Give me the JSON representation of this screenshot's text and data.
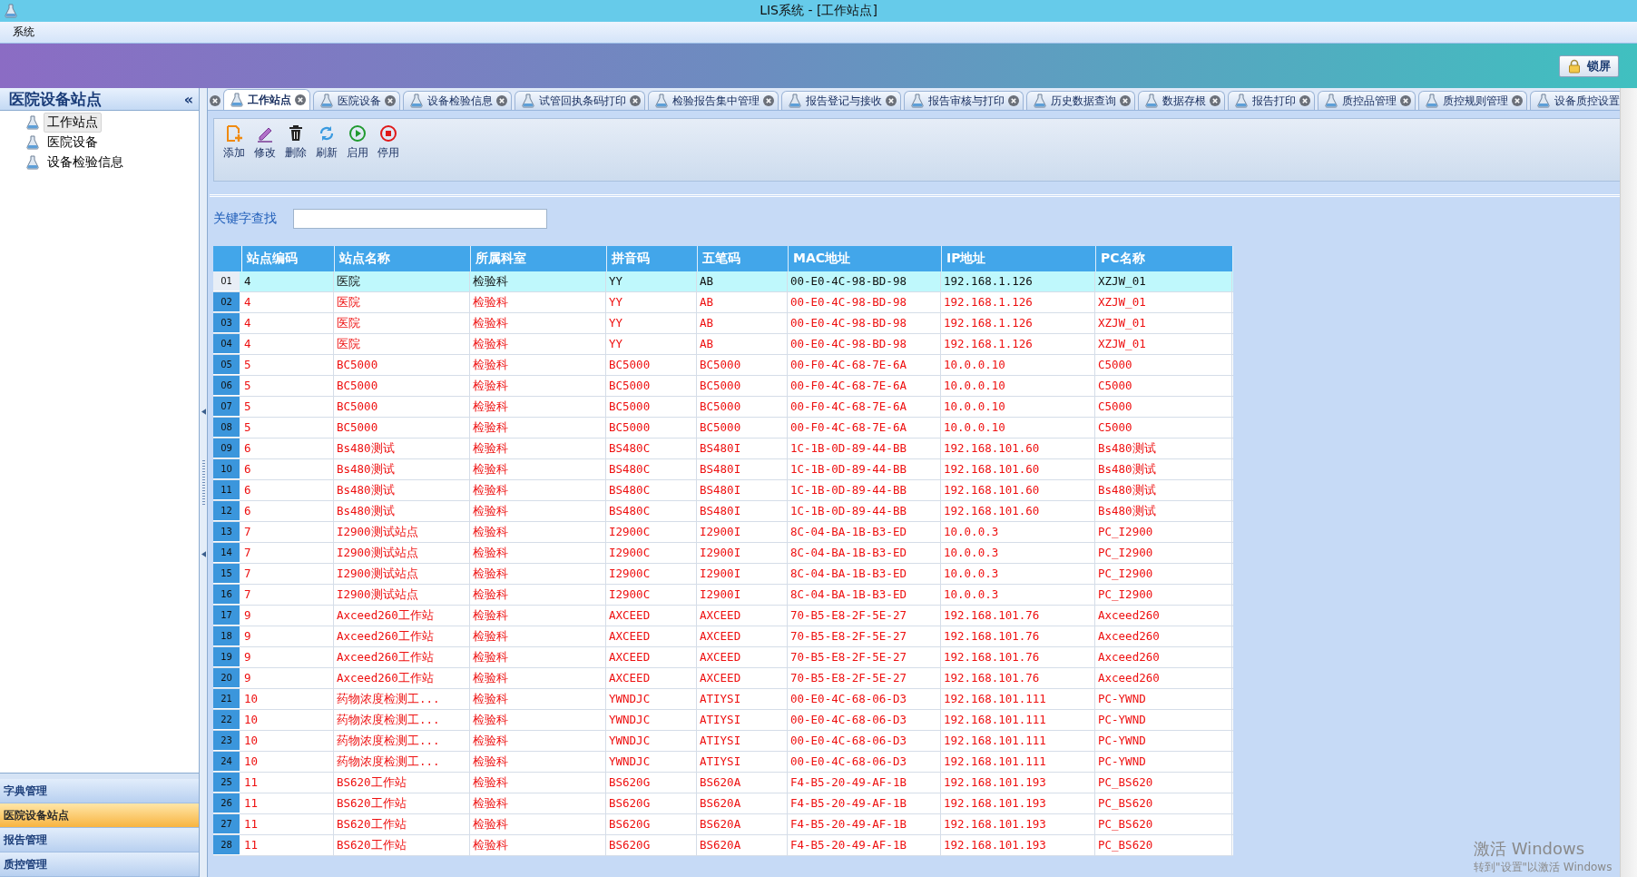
{
  "window": {
    "title": "LIS系统 - [工作站点]"
  },
  "menu": [
    "系统"
  ],
  "lock_button": "锁屏",
  "sidebar": {
    "title": "医院设备站点",
    "collapse": "«",
    "items": [
      {
        "label": "工作站点",
        "selected": true
      },
      {
        "label": "医院设备",
        "selected": false
      },
      {
        "label": "设备检验信息",
        "selected": false
      }
    ],
    "sections": [
      {
        "label": "字典管理",
        "selected": false
      },
      {
        "label": "医院设备站点",
        "selected": true
      },
      {
        "label": "报告管理",
        "selected": false
      },
      {
        "label": "质控管理",
        "selected": false
      }
    ]
  },
  "tabs": [
    {
      "label": "工作站点",
      "selected": true
    },
    {
      "label": "医院设备",
      "selected": false
    },
    {
      "label": "设备检验信息",
      "selected": false
    },
    {
      "label": "试管回执条码打印",
      "selected": false
    },
    {
      "label": "检验报告集中管理",
      "selected": false
    },
    {
      "label": "报告登记与接收",
      "selected": false
    },
    {
      "label": "报告审核与打印",
      "selected": false
    },
    {
      "label": "历史数据查询",
      "selected": false
    },
    {
      "label": "数据存根",
      "selected": false
    },
    {
      "label": "报告打印",
      "selected": false
    },
    {
      "label": "质控品管理",
      "selected": false
    },
    {
      "label": "质控规则管理",
      "selected": false
    },
    {
      "label": "设备质控设置",
      "selected": false
    }
  ],
  "toolbar": [
    {
      "kind": "add",
      "label": "添加"
    },
    {
      "kind": "edit",
      "label": "修改"
    },
    {
      "kind": "delete",
      "label": "删除"
    },
    {
      "kind": "refresh",
      "label": "刷新"
    },
    {
      "kind": "enable",
      "label": "启用"
    },
    {
      "kind": "disable",
      "label": "停用"
    }
  ],
  "search": {
    "label": "关键字查找"
  },
  "table": {
    "columns": [
      "站点编码",
      "站点名称",
      "所属科室",
      "拼音码",
      "五笔码",
      "MAC地址",
      "IP地址",
      "PC名称"
    ],
    "rows": [
      {
        "num": "01",
        "selected": true,
        "cells": [
          "4",
          "医院",
          "检验科",
          "YY",
          "AB",
          "00-E0-4C-98-BD-98",
          "192.168.1.126",
          "XZJW_01"
        ]
      },
      {
        "num": "02",
        "selected": false,
        "cells": [
          "4",
          "医院",
          "检验科",
          "YY",
          "AB",
          "00-E0-4C-98-BD-98",
          "192.168.1.126",
          "XZJW_01"
        ]
      },
      {
        "num": "03",
        "selected": false,
        "cells": [
          "4",
          "医院",
          "检验科",
          "YY",
          "AB",
          "00-E0-4C-98-BD-98",
          "192.168.1.126",
          "XZJW_01"
        ]
      },
      {
        "num": "04",
        "selected": false,
        "cells": [
          "4",
          "医院",
          "检验科",
          "YY",
          "AB",
          "00-E0-4C-98-BD-98",
          "192.168.1.126",
          "XZJW_01"
        ]
      },
      {
        "num": "05",
        "selected": false,
        "cells": [
          "5",
          "BC5000",
          "检验科",
          "BC5000",
          "BC5000",
          "00-F0-4C-68-7E-6A",
          "10.0.0.10",
          "C5000"
        ]
      },
      {
        "num": "06",
        "selected": false,
        "cells": [
          "5",
          "BC5000",
          "检验科",
          "BC5000",
          "BC5000",
          "00-F0-4C-68-7E-6A",
          "10.0.0.10",
          "C5000"
        ]
      },
      {
        "num": "07",
        "selected": false,
        "cells": [
          "5",
          "BC5000",
          "检验科",
          "BC5000",
          "BC5000",
          "00-F0-4C-68-7E-6A",
          "10.0.0.10",
          "C5000"
        ]
      },
      {
        "num": "08",
        "selected": false,
        "cells": [
          "5",
          "BC5000",
          "检验科",
          "BC5000",
          "BC5000",
          "00-F0-4C-68-7E-6A",
          "10.0.0.10",
          "C5000"
        ]
      },
      {
        "num": "09",
        "selected": false,
        "cells": [
          "6",
          "Bs480测试",
          "检验科",
          "BS480C",
          "BS480I",
          "1C-1B-0D-89-44-BB",
          "192.168.101.60",
          "Bs480测试"
        ]
      },
      {
        "num": "10",
        "selected": false,
        "cells": [
          "6",
          "Bs480测试",
          "检验科",
          "BS480C",
          "BS480I",
          "1C-1B-0D-89-44-BB",
          "192.168.101.60",
          "Bs480测试"
        ]
      },
      {
        "num": "11",
        "selected": false,
        "cells": [
          "6",
          "Bs480测试",
          "检验科",
          "BS480C",
          "BS480I",
          "1C-1B-0D-89-44-BB",
          "192.168.101.60",
          "Bs480测试"
        ]
      },
      {
        "num": "12",
        "selected": false,
        "cells": [
          "6",
          "Bs480测试",
          "检验科",
          "BS480C",
          "BS480I",
          "1C-1B-0D-89-44-BB",
          "192.168.101.60",
          "Bs480测试"
        ]
      },
      {
        "num": "13",
        "selected": false,
        "cells": [
          "7",
          "I2900测试站点",
          "检验科",
          "I2900C",
          "I2900I",
          "8C-04-BA-1B-B3-ED",
          "10.0.0.3",
          "PC_I2900"
        ]
      },
      {
        "num": "14",
        "selected": false,
        "cells": [
          "7",
          "I2900测试站点",
          "检验科",
          "I2900C",
          "I2900I",
          "8C-04-BA-1B-B3-ED",
          "10.0.0.3",
          "PC_I2900"
        ]
      },
      {
        "num": "15",
        "selected": false,
        "cells": [
          "7",
          "I2900测试站点",
          "检验科",
          "I2900C",
          "I2900I",
          "8C-04-BA-1B-B3-ED",
          "10.0.0.3",
          "PC_I2900"
        ]
      },
      {
        "num": "16",
        "selected": false,
        "cells": [
          "7",
          "I2900测试站点",
          "检验科",
          "I2900C",
          "I2900I",
          "8C-04-BA-1B-B3-ED",
          "10.0.0.3",
          "PC_I2900"
        ]
      },
      {
        "num": "17",
        "selected": false,
        "cells": [
          "9",
          "Axceed260工作站",
          "检验科",
          "AXCEED",
          "AXCEED",
          "70-B5-E8-2F-5E-27",
          "192.168.101.76",
          "Axceed260"
        ]
      },
      {
        "num": "18",
        "selected": false,
        "cells": [
          "9",
          "Axceed260工作站",
          "检验科",
          "AXCEED",
          "AXCEED",
          "70-B5-E8-2F-5E-27",
          "192.168.101.76",
          "Axceed260"
        ]
      },
      {
        "num": "19",
        "selected": false,
        "cells": [
          "9",
          "Axceed260工作站",
          "检验科",
          "AXCEED",
          "AXCEED",
          "70-B5-E8-2F-5E-27",
          "192.168.101.76",
          "Axceed260"
        ]
      },
      {
        "num": "20",
        "selected": false,
        "cells": [
          "9",
          "Axceed260工作站",
          "检验科",
          "AXCEED",
          "AXCEED",
          "70-B5-E8-2F-5E-27",
          "192.168.101.76",
          "Axceed260"
        ]
      },
      {
        "num": "21",
        "selected": false,
        "cells": [
          "10",
          "药物浓度检测工...",
          "检验科",
          "YWNDJC",
          "ATIYSI",
          "00-E0-4C-68-06-D3",
          "192.168.101.111",
          "PC-YWND"
        ]
      },
      {
        "num": "22",
        "selected": false,
        "cells": [
          "10",
          "药物浓度检测工...",
          "检验科",
          "YWNDJC",
          "ATIYSI",
          "00-E0-4C-68-06-D3",
          "192.168.101.111",
          "PC-YWND"
        ]
      },
      {
        "num": "23",
        "selected": false,
        "cells": [
          "10",
          "药物浓度检测工...",
          "检验科",
          "YWNDJC",
          "ATIYSI",
          "00-E0-4C-68-06-D3",
          "192.168.101.111",
          "PC-YWND"
        ]
      },
      {
        "num": "24",
        "selected": false,
        "cells": [
          "10",
          "药物浓度检测工...",
          "检验科",
          "YWNDJC",
          "ATIYSI",
          "00-E0-4C-68-06-D3",
          "192.168.101.111",
          "PC-YWND"
        ]
      },
      {
        "num": "25",
        "selected": false,
        "cells": [
          "11",
          "BS620工作站",
          "检验科",
          "BS620G",
          "BS620A",
          "F4-B5-20-49-AF-1B",
          "192.168.101.193",
          "PC_BS620"
        ]
      },
      {
        "num": "26",
        "selected": false,
        "cells": [
          "11",
          "BS620工作站",
          "检验科",
          "BS620G",
          "BS620A",
          "F4-B5-20-49-AF-1B",
          "192.168.101.193",
          "PC_BS620"
        ]
      },
      {
        "num": "27",
        "selected": false,
        "cells": [
          "11",
          "BS620工作站",
          "检验科",
          "BS620G",
          "BS620A",
          "F4-B5-20-49-AF-1B",
          "192.168.101.193",
          "PC_BS620"
        ]
      },
      {
        "num": "28",
        "selected": false,
        "cells": [
          "11",
          "BS620工作站",
          "检验科",
          "BS620G",
          "BS620A",
          "F4-B5-20-49-AF-1B",
          "192.168.101.193",
          "PC_BS620"
        ]
      }
    ]
  },
  "activation_notice": [
    "激活 Windows",
    "转到\"设置\"以激活 Windows"
  ]
}
